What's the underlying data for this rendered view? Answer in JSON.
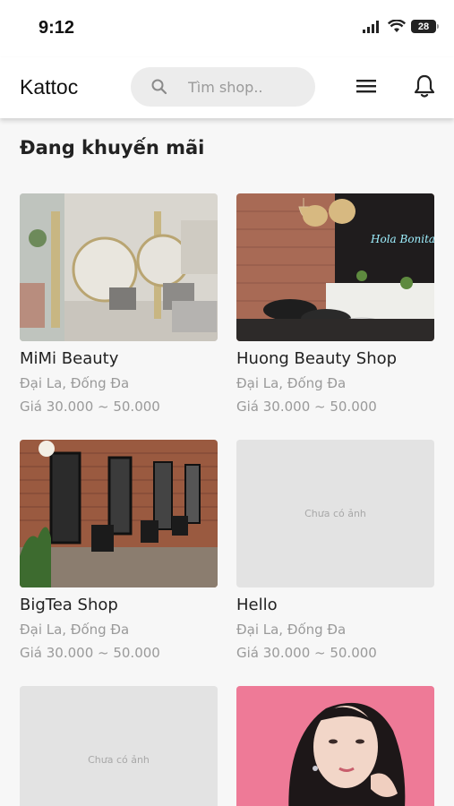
{
  "status_bar": {
    "time": "9:12",
    "battery": "28"
  },
  "app_bar": {
    "title": "Kattoc",
    "search_placeholder": "Tìm shop.."
  },
  "section": {
    "title": "Đang khuyến mãi"
  },
  "shops": [
    {
      "name": "MiMi Beauty",
      "address": "Đại La, Đống Đa",
      "price": "Giá 30.000 ~ 50.000",
      "image": "salon-interior"
    },
    {
      "name": "Huong Beauty Shop",
      "address": "Đại La, Đống Đa",
      "price": "Giá 30.000 ~ 50.000",
      "image": "wash-station"
    },
    {
      "name": "BigTea Shop",
      "address": "Đại La, Đống Đa",
      "price": "Giá 30.000 ~ 50.000",
      "image": "brick-salon"
    },
    {
      "name": "Hello",
      "address": "Đại La, Đống Đa",
      "price": "Giá 30.000 ~ 50.000",
      "image": "none",
      "no_image_text": "Chưa có ảnh"
    },
    {
      "name": "",
      "address": "",
      "price": "",
      "image": "none",
      "no_image_text": "Chưa có ảnh"
    },
    {
      "name": "",
      "address": "",
      "price": "",
      "image": "portrait"
    }
  ]
}
